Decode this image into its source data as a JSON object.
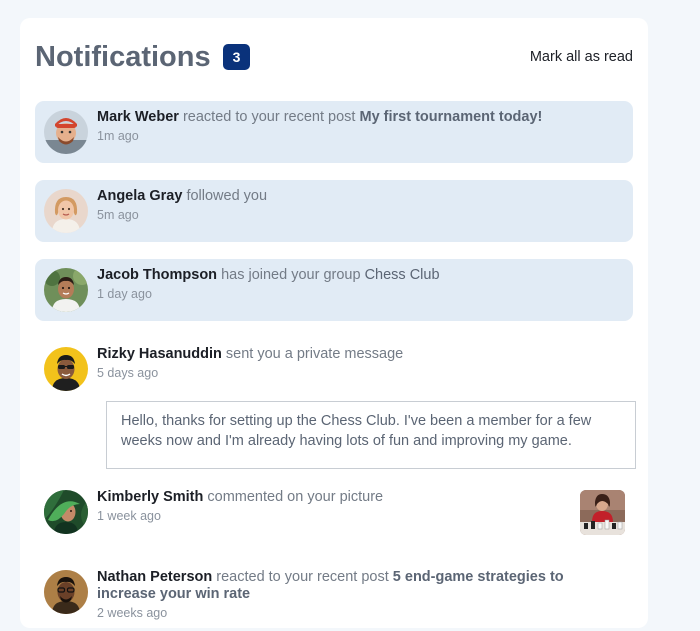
{
  "header": {
    "title": "Notifications",
    "unread_count": "3",
    "mark_all_label": "Mark all as read"
  },
  "notifications": [
    {
      "name": "Mark Weber",
      "action": "reacted to your recent post",
      "post": "My first tournament today!",
      "time": "1m ago",
      "unread": true,
      "avatar_icon": "avatar-mark-weber"
    },
    {
      "name": "Angela Gray",
      "action": "followed you",
      "time": "5m ago",
      "unread": true,
      "avatar_icon": "avatar-angela-gray"
    },
    {
      "name": "Jacob Thompson",
      "action": "has joined your group",
      "group": "Chess Club",
      "time": "1 day ago",
      "unread": true,
      "avatar_icon": "avatar-jacob-thompson"
    },
    {
      "name": "Rizky Hasanuddin",
      "action": "sent you a private message",
      "time": "5 days ago",
      "unread": false,
      "message": "Hello, thanks for setting up the Chess Club. I've been a member for a few weeks now and I'm already having lots of fun and improving my game.",
      "avatar_icon": "avatar-rizky-hasanuddin"
    },
    {
      "name": "Kimberly Smith",
      "action": "commented on your picture",
      "time": "1 week ago",
      "unread": false,
      "picture_icon": "chess-picture-thumbnail",
      "avatar_icon": "avatar-kimberly-smith"
    },
    {
      "name": "Nathan Peterson",
      "action": "reacted to your recent post",
      "post": "5 end-game strategies to increase your win rate",
      "time": "2 weeks ago",
      "unread": false,
      "avatar_icon": "avatar-nathan-peterson"
    }
  ],
  "colors": {
    "badge": "#0a327b",
    "unread_bg": "#e1ebf5",
    "title": "#5b6574",
    "name": "#1c1f26"
  }
}
